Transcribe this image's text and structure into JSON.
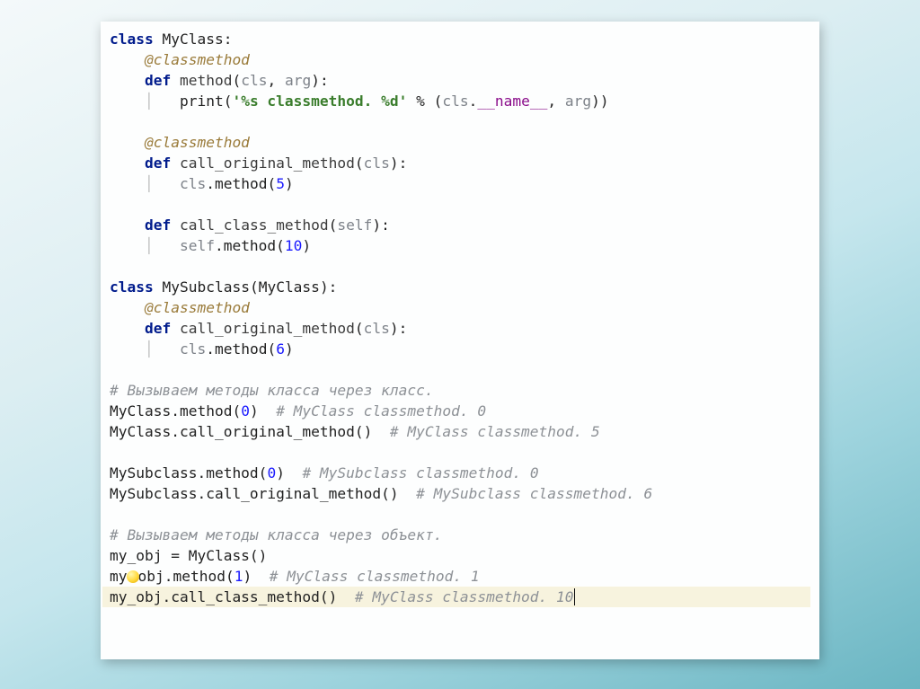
{
  "code": {
    "l1": {
      "kw": "class",
      "name": "MyClass"
    },
    "l2": {
      "dec": "@classmethod"
    },
    "l3": {
      "kw": "def",
      "name": "method",
      "p1": "cls",
      "p2": "arg"
    },
    "l4a": "print(",
    "l4str": "'%s classmethod. %d'",
    "l4b": " % (",
    "l4cls": "cls",
    "l4name": "__name__",
    "l4arg": "arg",
    "l4end": "))",
    "l6": {
      "dec": "@classmethod"
    },
    "l7": {
      "kw": "def",
      "name": "call_original_method",
      "p1": "cls"
    },
    "l8": {
      "obj": "cls",
      "call": ".method(",
      "n": "5",
      "end": ")"
    },
    "l10": {
      "kw": "def",
      "name": "call_class_method",
      "p1": "self"
    },
    "l11": {
      "obj": "self",
      "call": ".method(",
      "n": "10",
      "end": ")"
    },
    "l13": {
      "kw": "class",
      "name": "MySubclass",
      "base": "MyClass"
    },
    "l14": {
      "dec": "@classmethod"
    },
    "l15": {
      "kw": "def",
      "name": "call_original_method",
      "p1": "cls"
    },
    "l16": {
      "obj": "cls",
      "call": ".method(",
      "n": "6",
      "end": ")"
    },
    "c1": "# Вызываем методы класса через класс.",
    "l18": {
      "a": "MyClass.method(",
      "n": "0",
      "b": ")",
      "c": "# MyClass classmethod. 0"
    },
    "l19": {
      "a": "MyClass.call_original_method()",
      "c": "# MyClass classmethod. 5"
    },
    "l21": {
      "a": "MySubclass.method(",
      "n": "0",
      "b": ")",
      "c": "# MySubclass classmethod. 0"
    },
    "l22": {
      "a": "MySubclass.call_original_method()",
      "c": "# MySubclass classmethod. 6"
    },
    "c2": "# Вызываем методы класса через объект.",
    "l25": {
      "a": "my_obj = MyClass()"
    },
    "l26": {
      "a": "my",
      "b": "obj.method(",
      "n": "1",
      "c": ")",
      "d": "# MyClass classmethod. 1"
    },
    "l27": {
      "a": "my_obj.call_class_method()",
      "c": "# MyClass classmethod. 10"
    }
  }
}
